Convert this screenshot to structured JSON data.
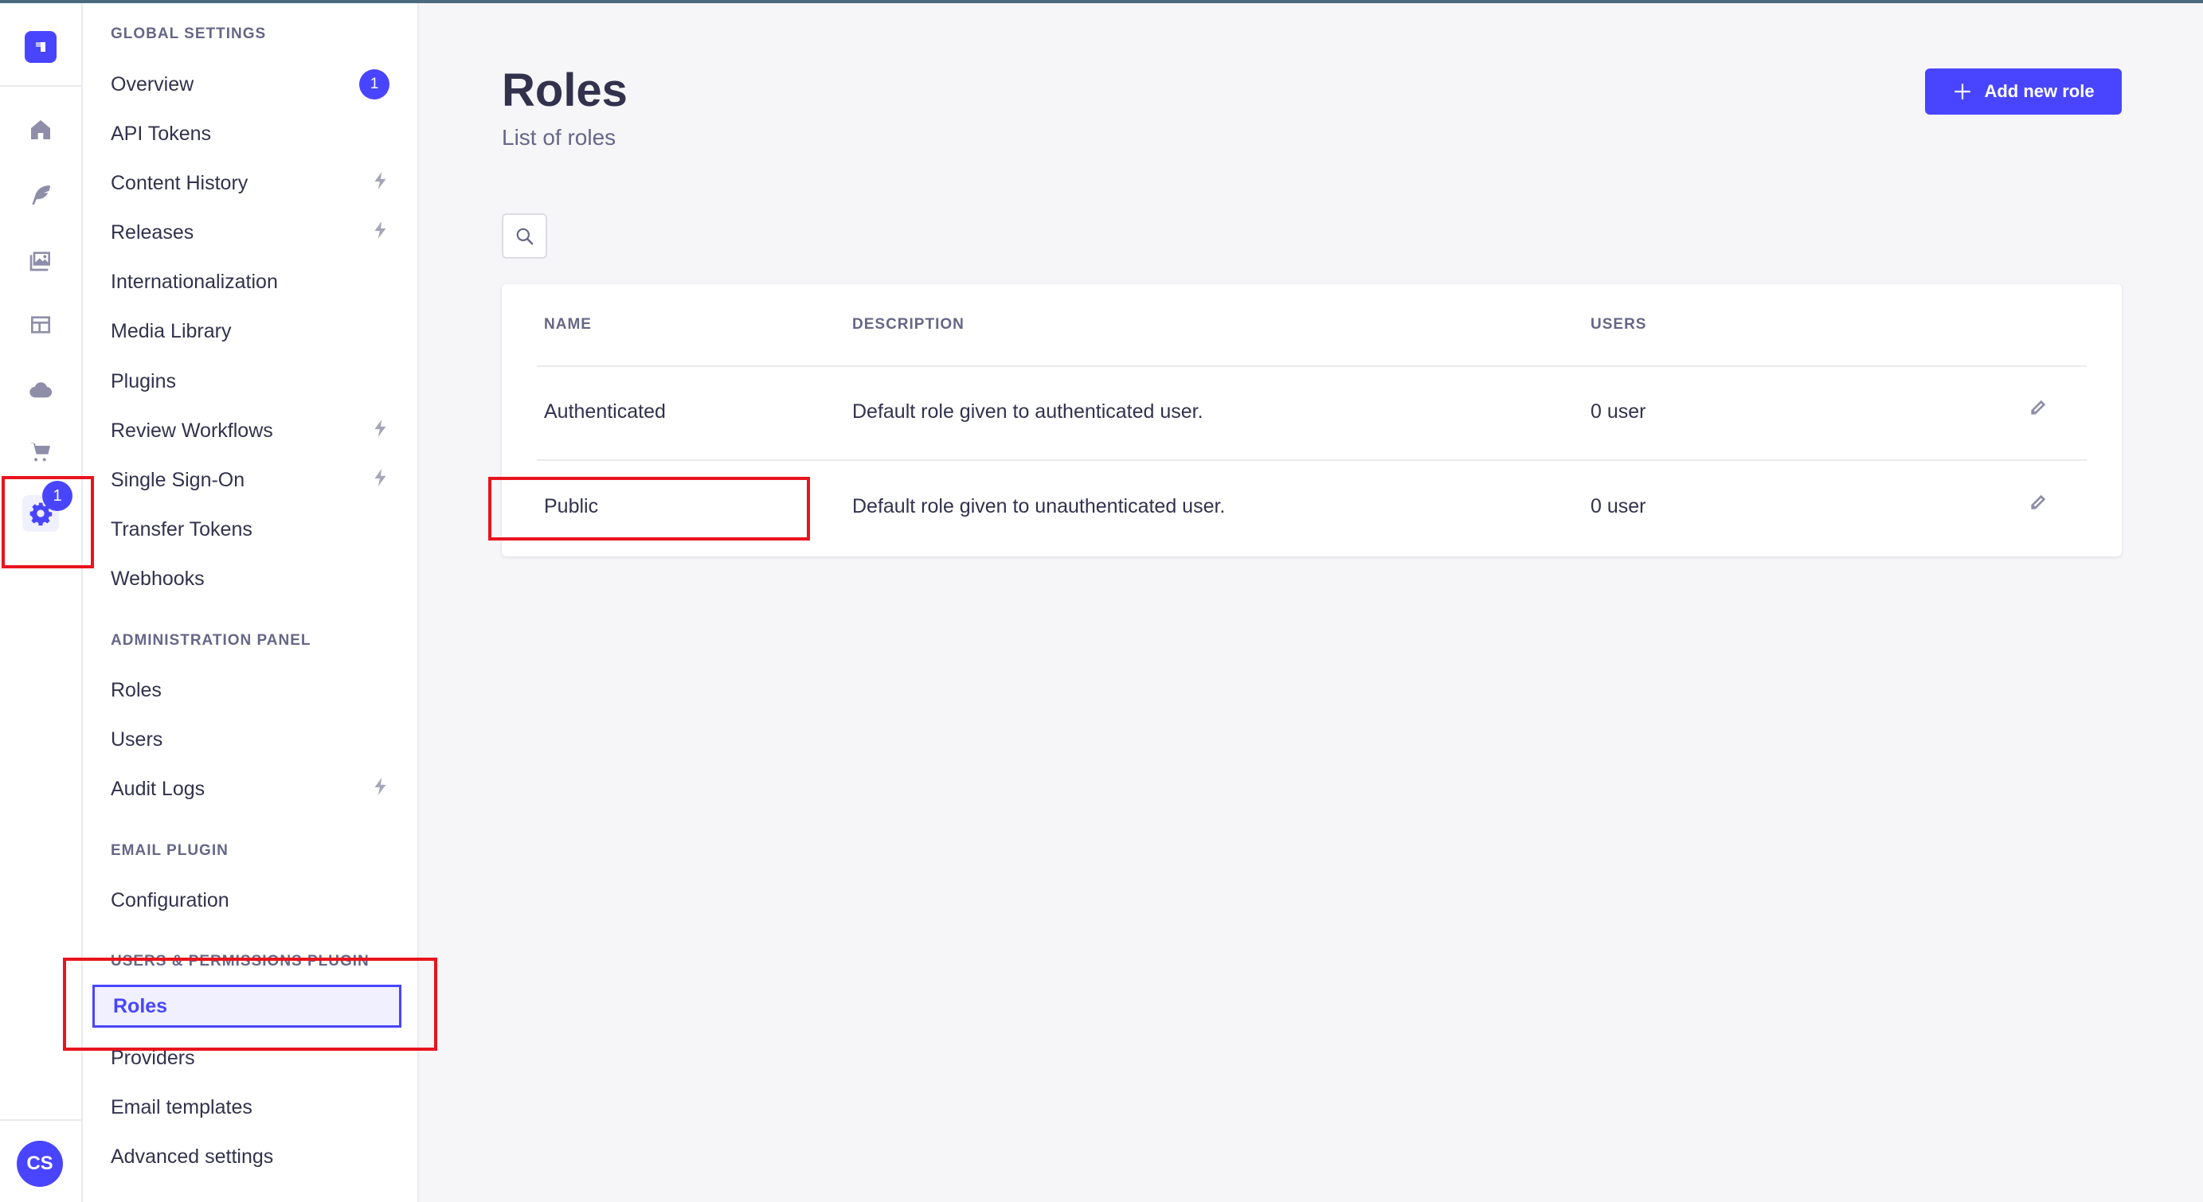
{
  "sidebar_rail": {
    "icons": [
      "home-icon",
      "feather-icon",
      "images-icon",
      "layout-icon",
      "cloud-icon",
      "cart-icon",
      "gear-icon"
    ],
    "settings_badge": "1",
    "avatar_initials": "CS"
  },
  "subnav": {
    "global_settings": {
      "title": "GLOBAL SETTINGS",
      "items": [
        {
          "label": "Overview",
          "badge": "1"
        },
        {
          "label": "API Tokens"
        },
        {
          "label": "Content History",
          "bolt": true
        },
        {
          "label": "Releases",
          "bolt": true
        },
        {
          "label": "Internationalization"
        },
        {
          "label": "Media Library"
        },
        {
          "label": "Plugins"
        },
        {
          "label": "Review Workflows",
          "bolt": true
        },
        {
          "label": "Single Sign-On",
          "bolt": true
        },
        {
          "label": "Transfer Tokens"
        },
        {
          "label": "Webhooks"
        }
      ]
    },
    "admin_panel": {
      "title": "ADMINISTRATION PANEL",
      "items": [
        {
          "label": "Roles"
        },
        {
          "label": "Users"
        },
        {
          "label": "Audit Logs",
          "bolt": true
        }
      ]
    },
    "email_plugin": {
      "title": "EMAIL PLUGIN",
      "items": [
        {
          "label": "Configuration"
        }
      ]
    },
    "users_permissions": {
      "title": "USERS & PERMISSIONS PLUGIN",
      "items": [
        {
          "label": "Roles",
          "active": true
        },
        {
          "label": "Providers"
        },
        {
          "label": "Email templates"
        },
        {
          "label": "Advanced settings"
        }
      ]
    }
  },
  "main": {
    "title": "Roles",
    "subtitle": "List of roles",
    "add_button": "Add new role",
    "table": {
      "headers": [
        "NAME",
        "DESCRIPTION",
        "USERS"
      ],
      "rows": [
        {
          "name": "Authenticated",
          "description": "Default role given to authenticated user.",
          "users": "0 user"
        },
        {
          "name": "Public",
          "description": "Default role given to unauthenticated user.",
          "users": "0 user"
        }
      ]
    }
  },
  "colors": {
    "accent": "#4945ff",
    "annotation": "#e8141e"
  }
}
